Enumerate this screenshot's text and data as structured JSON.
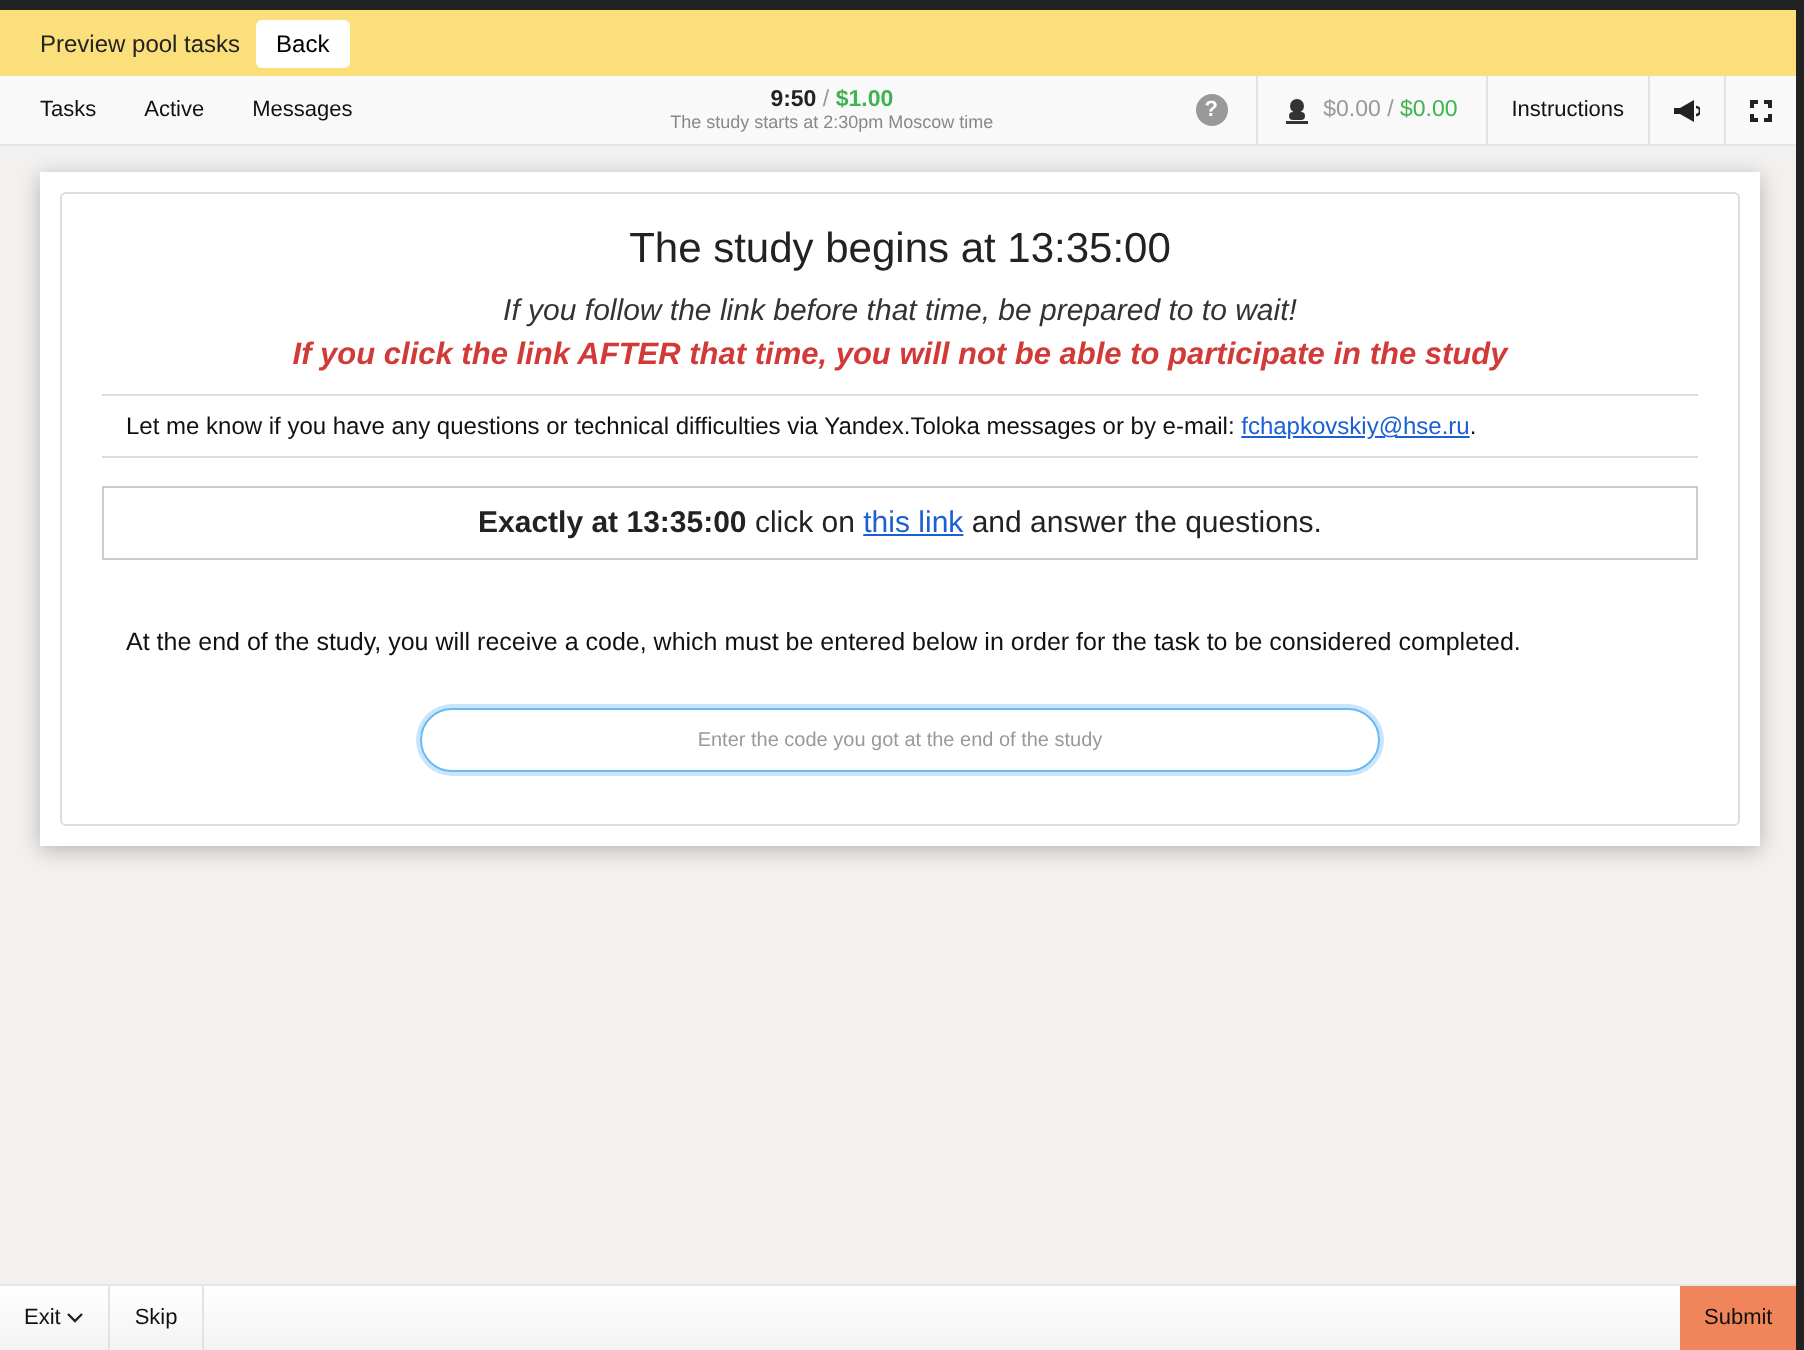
{
  "top_bar": {
    "title": "Preview pool tasks",
    "back_button": "Back"
  },
  "nav": {
    "tabs": [
      {
        "label": "Tasks"
      },
      {
        "label": "Active"
      },
      {
        "label": "Messages"
      }
    ],
    "timer": "9:50",
    "separator": "/",
    "reward": "$1.00",
    "subtitle": "The study starts at 2:30pm Moscow time",
    "help": "?",
    "earned": "$0.00",
    "earned_separator": "/",
    "earned_total": "$0.00",
    "instructions": "Instructions"
  },
  "task": {
    "heading": "The study begins at 13:35:00",
    "warning": "If you follow the link before that time, be prepared to to wait!",
    "alert": "If you click the link AFTER that time, you will not be able to participate in the study",
    "contact": {
      "before": "Let me know if you have any questions or technical difficulties via Yandex.Toloka messages or by e-mail: ",
      "link": "fchapkovskiy@hse.ru",
      "after": "."
    },
    "instruction": {
      "before": "**Exactly at 13:35:00** click on ",
      "link": "this link",
      "after": " and answer the questions."
    },
    "note": "At the end of the study, you will receive a code, which must be entered below in order for the task to be considered completed.",
    "code_field": {
      "placeholder": "Enter the code you got at the end of the study"
    }
  },
  "footer": {
    "exit": "Exit",
    "skip": "Skip",
    "submit": "Submit"
  }
}
